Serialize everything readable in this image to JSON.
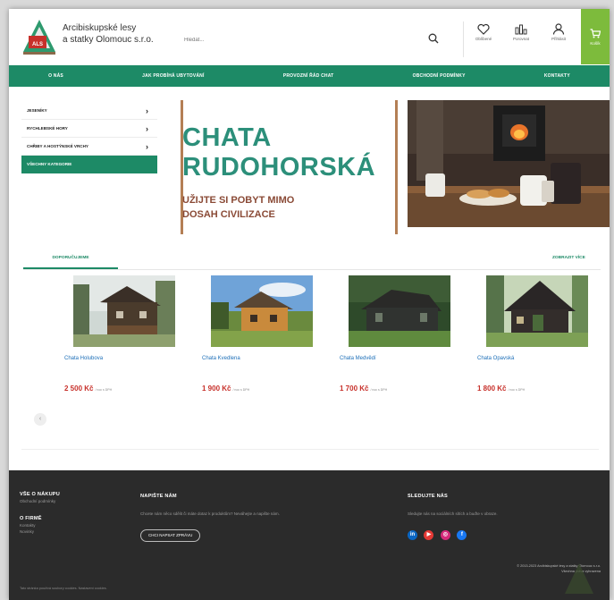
{
  "header": {
    "logo_line1": "Arcibiskupské lesy",
    "logo_line2": "a statky Olomouc s.r.o.",
    "search_placeholder": "Hledat...",
    "links": [
      {
        "label": "Oblíbené",
        "icon": "heart-icon"
      },
      {
        "label": "Porovnat",
        "icon": "compare-icon"
      },
      {
        "label": "Přihlásit",
        "icon": "user-icon"
      }
    ],
    "cart_label": "Košík"
  },
  "nav": [
    "O NÁS",
    "JAK PROBÍHÁ UBYTOVÁNÍ",
    "PROVOZNÍ ŘÁD CHAT",
    "OBCHODNÍ PODMÍNKY",
    "KONTAKTY"
  ],
  "sidebar": [
    {
      "label": "JESENÍKY"
    },
    {
      "label": "RYCHLEBSKÉ HORY"
    },
    {
      "label": "CHŘIBY A HOSTÝNSKÉ VRCHY"
    },
    {
      "label": "VŠECHNY KATEGORIE"
    }
  ],
  "banner": {
    "title_line1": "CHATA",
    "title_line2": "RUDOHORSKÁ",
    "subtitle_line1": "UŽIJTE SI POBYT MIMO",
    "subtitle_line2": "DOSAH CIVILIZACE"
  },
  "recommended": {
    "tab": "DOPORUČUJEME",
    "more": "ZOBRAZIT VÍCE",
    "products": [
      {
        "name": "Chata Holubova",
        "price": "2 500 Kč",
        "vat": "/ noc s DPH"
      },
      {
        "name": "Chata Kvedlena",
        "price": "1 900 Kč",
        "vat": "/ noc s DPH"
      },
      {
        "name": "Chata Medvědí",
        "price": "1 700 Kč",
        "vat": "/ noc s DPH"
      },
      {
        "name": "Chata Opavská",
        "price": "1 800 Kč",
        "vat": "/ noc s DPH"
      }
    ],
    "slider_prev": "‹"
  },
  "footer": {
    "col1_heading": "VŠE O NÁKUPU",
    "col1_link": "Obchodní podmínky",
    "col1b_heading": "O FIRMĚ",
    "col1b_links": [
      "Kontakty",
      "Novinky"
    ],
    "col2_heading": "NAPIŠTE NÁM",
    "col2_text": "Chcete nám něco sdělit či máte dotaz k produktům? Neváhejte a napište nám.",
    "col2_button": "CHCI NAPSAT ZPRÁVU",
    "col3_heading": "SLEDUJTE NÁS",
    "col3_text": "Sledujte nás na sociálních sítích a buďte v obraze.",
    "social": [
      {
        "name": "linkedin",
        "color": "#0a66c2",
        "glyph": "in"
      },
      {
        "name": "youtube",
        "color": "#e53935",
        "glyph": "▶"
      },
      {
        "name": "instagram",
        "color": "#d6297a",
        "glyph": "◎"
      },
      {
        "name": "facebook",
        "color": "#1877f2",
        "glyph": "f"
      }
    ],
    "copyright": "© 2013-2023 Arcibiskupské lesy a statky Olomouc s.r.o.",
    "rights": "Všechna práva vyhrazena",
    "bottom_left": "Tato stránka používá soubory cookies. Nastavení cookies."
  },
  "colors": {
    "brand_green": "#1d8a66",
    "title_teal": "#2c8f7a",
    "sub_brown": "#8a4a36",
    "price_red": "#c7302a",
    "cart_green": "#7dbb3c"
  }
}
